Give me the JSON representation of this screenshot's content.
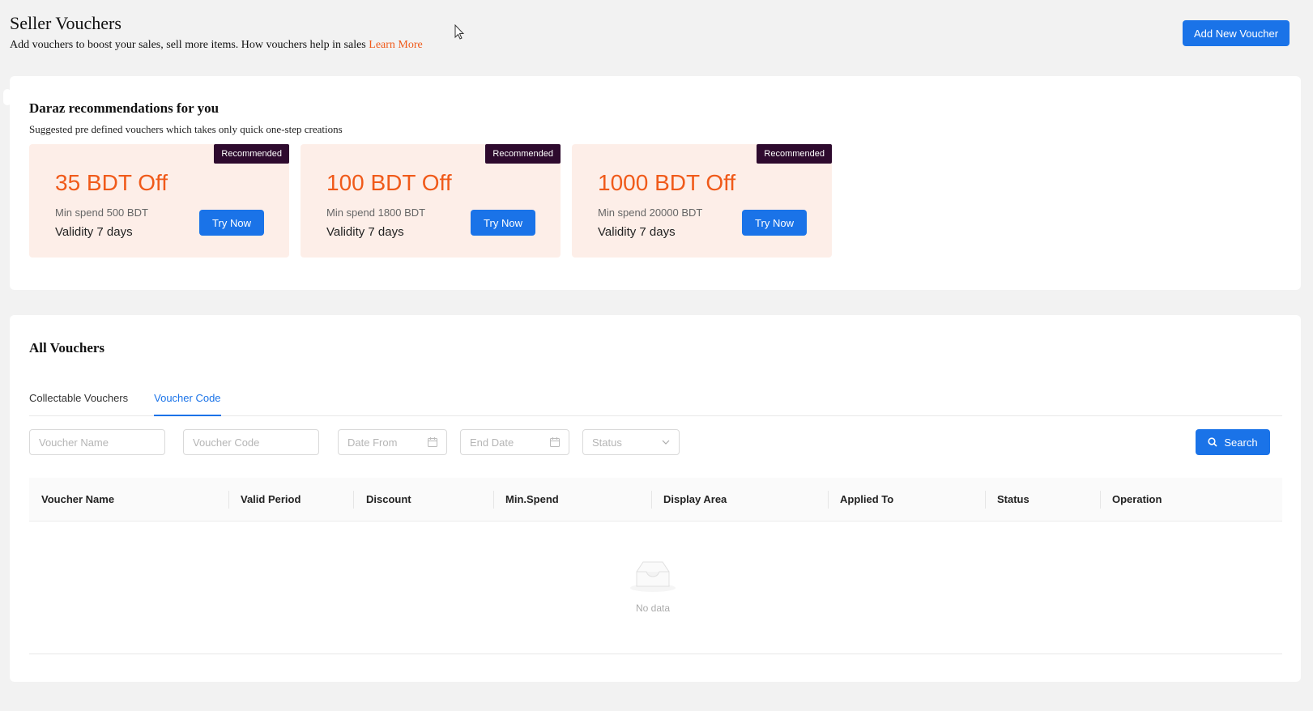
{
  "header": {
    "title": "Seller Vouchers",
    "subtitle": "Add vouchers to boost your sales, sell more items. How vouchers help in sales",
    "learn_more": "Learn More",
    "add_button": "Add New Voucher"
  },
  "recommendations": {
    "title": "Daraz recommendations for you",
    "subtitle": "Suggested pre defined vouchers which takes only quick one-step creations",
    "items": [
      {
        "badge": "Recommended",
        "amount": "35 BDT Off",
        "min_spend": "Min spend 500 BDT",
        "validity": "Validity 7 days",
        "button": "Try Now"
      },
      {
        "badge": "Recommended",
        "amount": "100 BDT Off",
        "min_spend": "Min spend 1800 BDT",
        "validity": "Validity 7 days",
        "button": "Try Now"
      },
      {
        "badge": "Recommended",
        "amount": "1000 BDT Off",
        "min_spend": "Min spend 20000 BDT",
        "validity": "Validity 7 days",
        "button": "Try Now"
      }
    ]
  },
  "all_vouchers": {
    "title": "All Vouchers",
    "tabs": [
      {
        "label": "Collectable Vouchers",
        "active": false
      },
      {
        "label": "Voucher Code",
        "active": true
      }
    ],
    "filters": {
      "voucher_name_placeholder": "Voucher Name",
      "voucher_code_placeholder": "Voucher Code",
      "date_from": "Date From",
      "end_date": "End Date",
      "status": "Status",
      "search_button": "Search"
    },
    "columns": [
      "Voucher Name",
      "Valid Period",
      "Discount",
      "Min.Spend",
      "Display Area",
      "Applied To",
      "Status",
      "Operation"
    ],
    "empty_text": "No data"
  },
  "colors": {
    "primary": "#1a73e8",
    "accent_orange": "#f05a1a",
    "badge_bg": "#2e0a2e",
    "voucher_bg": "#fdeee8"
  }
}
